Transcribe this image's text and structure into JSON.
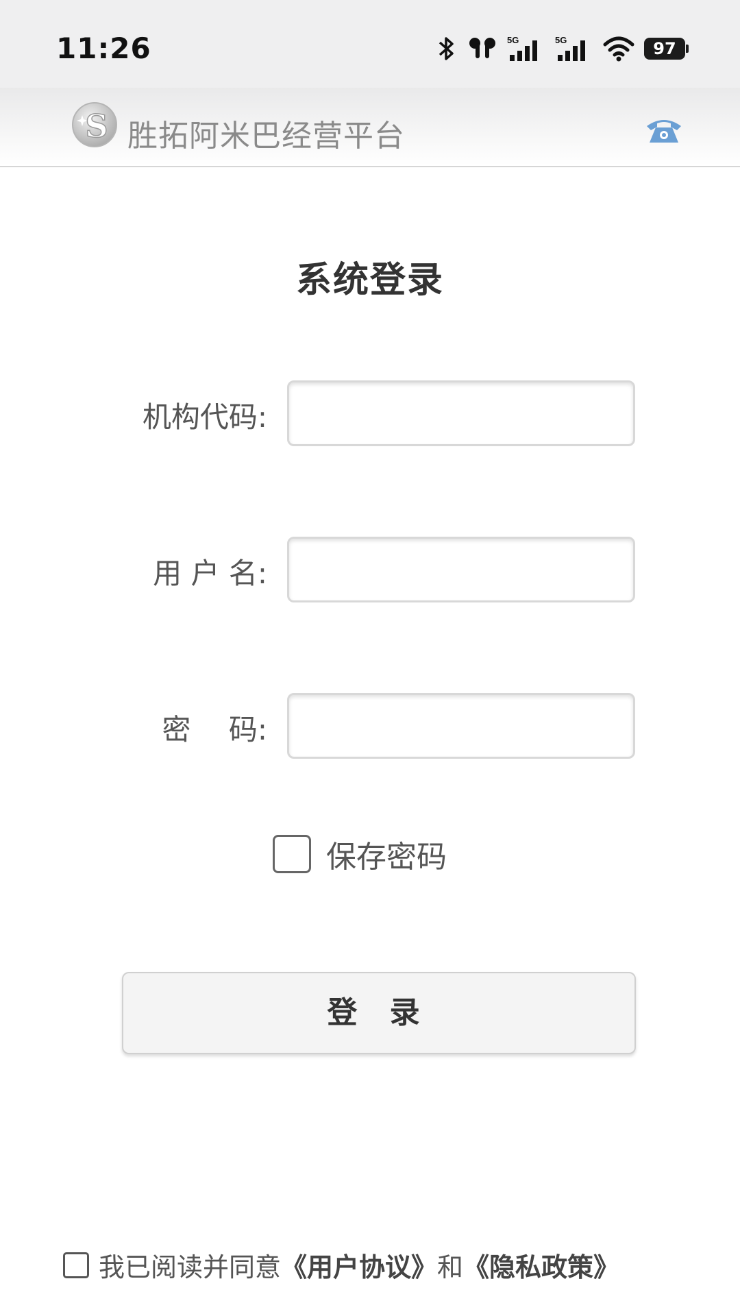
{
  "status_bar": {
    "time": "11:26",
    "battery": "97",
    "network_1": "5G",
    "network_2": "5G"
  },
  "header": {
    "app_title": "胜拓阿米巴经营平台",
    "logo_letter": "S"
  },
  "login": {
    "title": "系统登录",
    "org_code_label": "机构代码:",
    "username_label": "用 户 名:",
    "password_label": "密　 码:",
    "save_password_label": "保存密码",
    "submit_label": "登 录"
  },
  "agreement": {
    "prefix": "我已阅读并同意",
    "user_agreement": "《用户协议》",
    "conjunction": "和",
    "privacy_policy": "《隐私政策》"
  },
  "colors": {
    "phone_icon": "#6a9fd4",
    "header_text": "#8a8a8a"
  }
}
